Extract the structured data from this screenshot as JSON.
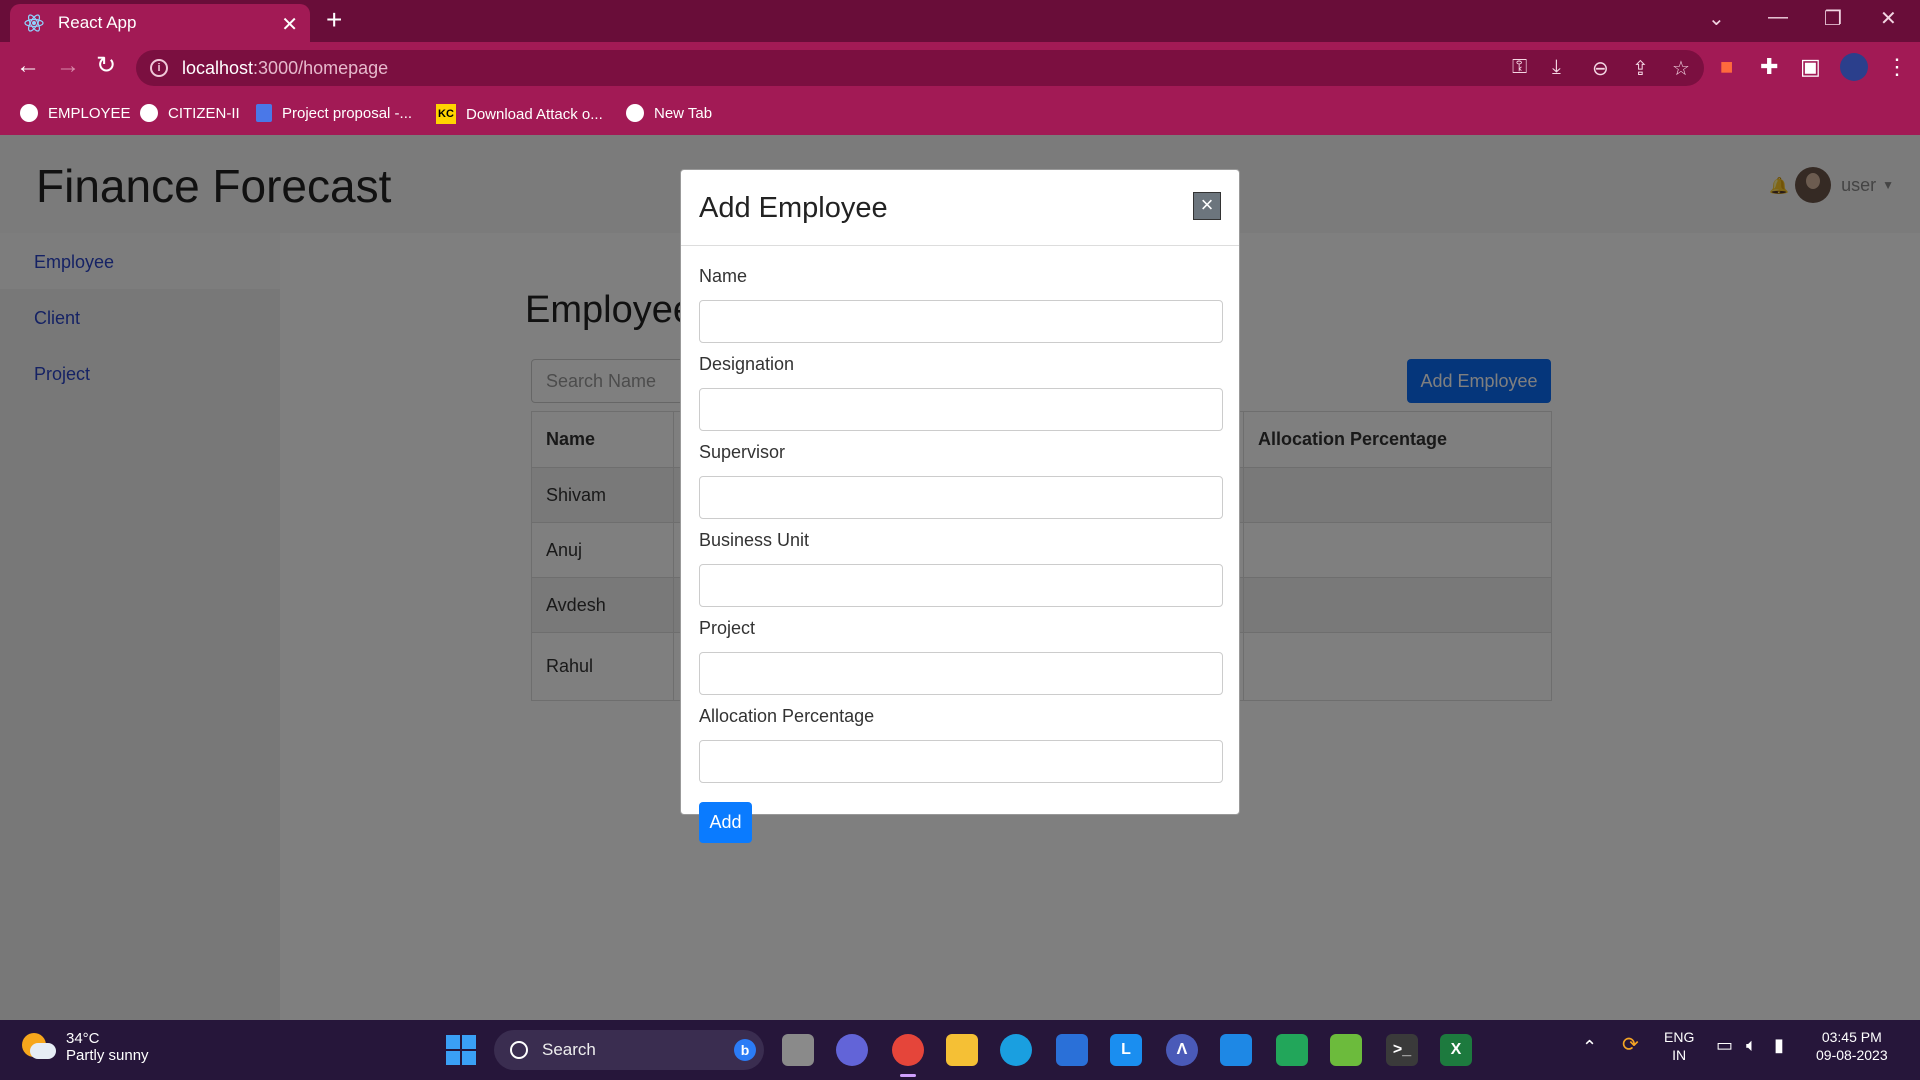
{
  "browser": {
    "tab_title": "React App",
    "url_host": "localhost",
    "url_rest": ":3000/homepage",
    "bookmarks": [
      "EMPLOYEE",
      "CITIZEN-II",
      "Project proposal -...",
      "Download Attack o...",
      "New Tab"
    ]
  },
  "app": {
    "brand": "Finance Forecast",
    "user_label": "user",
    "sidebar": [
      "Employee",
      "Client",
      "Project"
    ],
    "page_title": "Employee",
    "search_placeholder": "Search Name",
    "add_button": "Add Employee",
    "table": {
      "headers": [
        "Name",
        "",
        "",
        "",
        "Allocation Percentage"
      ],
      "rows": [
        [
          "Shivam",
          "",
          "",
          "",
          ""
        ],
        [
          "Anuj",
          "",
          "",
          "",
          ""
        ],
        [
          "Avdesh",
          "",
          "",
          "",
          ""
        ],
        [
          "Rahul",
          "",
          "",
          "",
          ""
        ]
      ]
    }
  },
  "modal": {
    "title": "Add Employee",
    "close_label": "×",
    "fields": [
      {
        "label": "Name",
        "value": ""
      },
      {
        "label": "Designation",
        "value": ""
      },
      {
        "label": "Supervisor",
        "value": ""
      },
      {
        "label": "Business Unit",
        "value": ""
      },
      {
        "label": "Project",
        "value": ""
      },
      {
        "label": "Allocation Percentage",
        "value": ""
      }
    ],
    "submit_label": "Add"
  },
  "taskbar": {
    "temperature": "34°C",
    "condition": "Partly sunny",
    "search_label": "Search",
    "lang_1": "ENG",
    "lang_2": "IN",
    "time": "03:45 PM",
    "date": "09-08-2023"
  },
  "colors": {
    "accent_blue": "#0a6cf7",
    "browser_frame": "#a21a55",
    "taskbar_bg": "#26163a"
  }
}
